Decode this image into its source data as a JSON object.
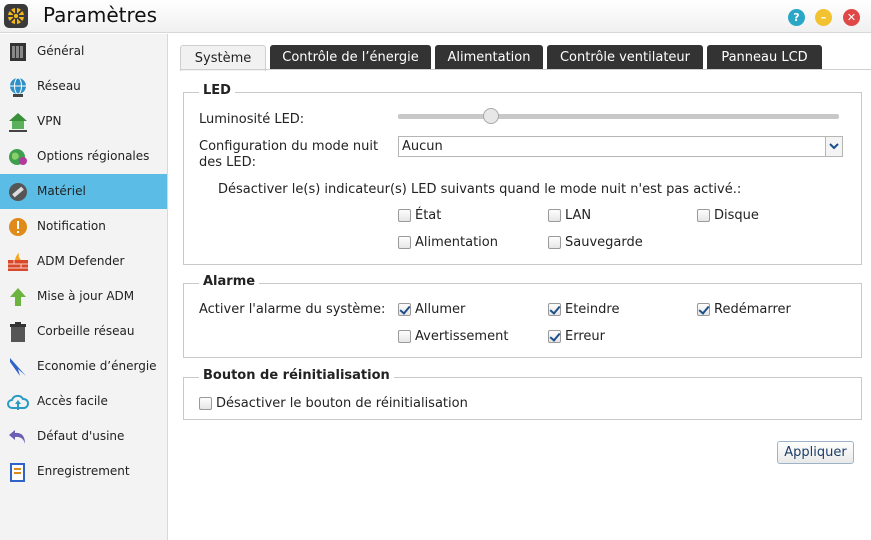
{
  "window": {
    "title": "Paramètres",
    "help": "?",
    "minimize": "–",
    "close": "✕"
  },
  "sidebar": {
    "items": [
      {
        "label": "Général",
        "icon": "server-icon"
      },
      {
        "label": "Réseau",
        "icon": "globe-icon"
      },
      {
        "label": "VPN",
        "icon": "vpn-house-icon"
      },
      {
        "label": "Options régionales",
        "icon": "region-globe-icon"
      },
      {
        "label": "Matériel",
        "icon": "wrench-icon",
        "active": true
      },
      {
        "label": "Notification",
        "icon": "alert-icon"
      },
      {
        "label": "ADM Defender",
        "icon": "firewall-icon"
      },
      {
        "label": "Mise à jour ADM",
        "icon": "update-arrow-icon"
      },
      {
        "label": "Corbeille réseau",
        "icon": "trash-icon"
      },
      {
        "label": "Economie d’énergie",
        "icon": "energy-icon"
      },
      {
        "label": "Accès facile",
        "icon": "cloud-icon"
      },
      {
        "label": "Défaut d'usine",
        "icon": "reset-icon"
      },
      {
        "label": "Enregistrement",
        "icon": "register-icon"
      }
    ]
  },
  "tabs": [
    {
      "label": "Système",
      "active": true
    },
    {
      "label": "Contrôle de l’énergie"
    },
    {
      "label": "Alimentation"
    },
    {
      "label": "Contrôle ventilateur"
    },
    {
      "label": "Panneau LCD"
    }
  ],
  "led": {
    "legend": "LED",
    "brightness_label": "Luminosité LED:",
    "brightness_level": 0.2,
    "night_mode_label_1": "Configuration du mode nuit",
    "night_mode_label_2": "des LED:",
    "night_mode_value": "Aucun",
    "disable_text": "Désactiver le(s) indicateur(s) LED suivants quand le mode nuit n'est pas activé.:",
    "options": [
      {
        "label": "État",
        "checked": false
      },
      {
        "label": "LAN",
        "checked": false
      },
      {
        "label": "Disque",
        "checked": false
      },
      {
        "label": "Alimentation",
        "checked": false
      },
      {
        "label": "Sauvegarde",
        "checked": false
      }
    ]
  },
  "alarm": {
    "legend": "Alarme",
    "enable_label": "Activer l'alarme du système:",
    "options": [
      {
        "label": "Allumer",
        "checked": true
      },
      {
        "label": "Eteindre",
        "checked": true
      },
      {
        "label": "Redémarrer",
        "checked": true
      },
      {
        "label": "Avertissement",
        "checked": false
      },
      {
        "label": "Erreur",
        "checked": true
      }
    ]
  },
  "reset": {
    "legend": "Bouton de réinitialisation",
    "disable_label": "Désactiver le bouton de réinitialisation",
    "checked": false
  },
  "apply_label": "Appliquer"
}
